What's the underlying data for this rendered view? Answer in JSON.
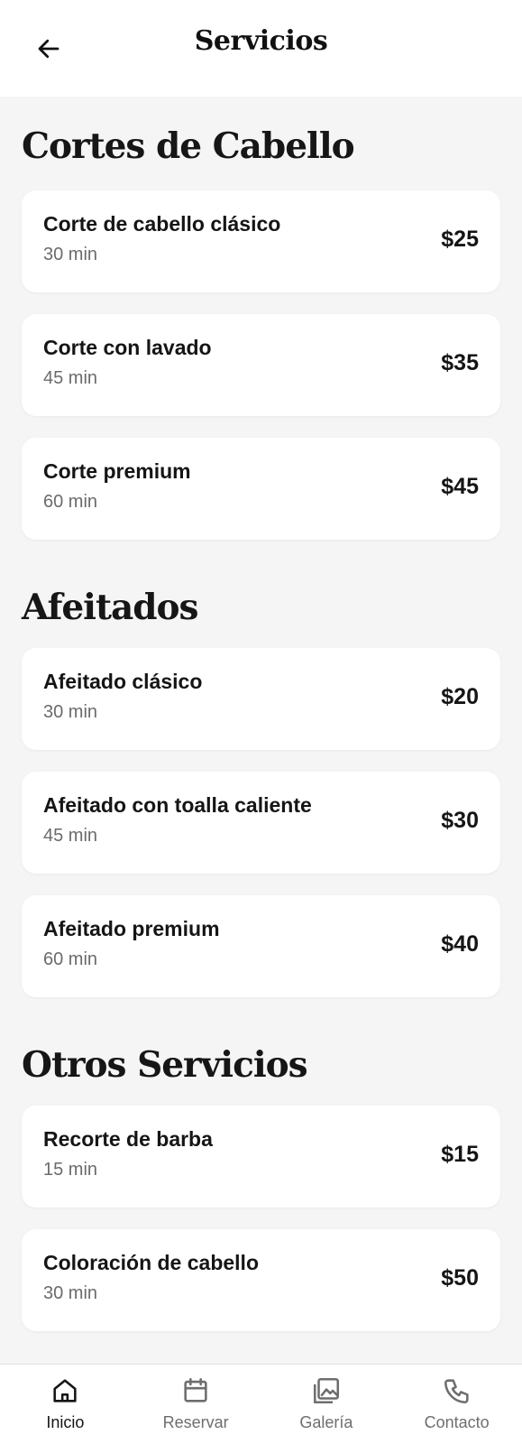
{
  "header": {
    "title": "Servicios"
  },
  "sections": [
    {
      "title": "Cortes de Cabello",
      "items": [
        {
          "name": "Corte de cabello clásico",
          "duration": "30 min",
          "price": "$25"
        },
        {
          "name": "Corte con lavado",
          "duration": "45 min",
          "price": "$35"
        },
        {
          "name": "Corte premium",
          "duration": "60 min",
          "price": "$45"
        }
      ]
    },
    {
      "title": "Afeitados",
      "items": [
        {
          "name": "Afeitado clásico",
          "duration": "30 min",
          "price": "$20"
        },
        {
          "name": "Afeitado con toalla caliente",
          "duration": "45 min",
          "price": "$30"
        },
        {
          "name": "Afeitado premium",
          "duration": "60 min",
          "price": "$40"
        }
      ]
    },
    {
      "title": "Otros Servicios",
      "items": [
        {
          "name": "Recorte de barba",
          "duration": "15 min",
          "price": "$15"
        },
        {
          "name": "Coloración de cabello",
          "duration": "30 min",
          "price": "$50"
        }
      ]
    }
  ],
  "nav": {
    "items": [
      {
        "label": "Inicio",
        "icon": "home-icon",
        "active": true
      },
      {
        "label": "Reservar",
        "icon": "calendar-icon",
        "active": false
      },
      {
        "label": "Galería",
        "icon": "gallery-icon",
        "active": false
      },
      {
        "label": "Contacto",
        "icon": "phone-icon",
        "active": false
      }
    ]
  }
}
